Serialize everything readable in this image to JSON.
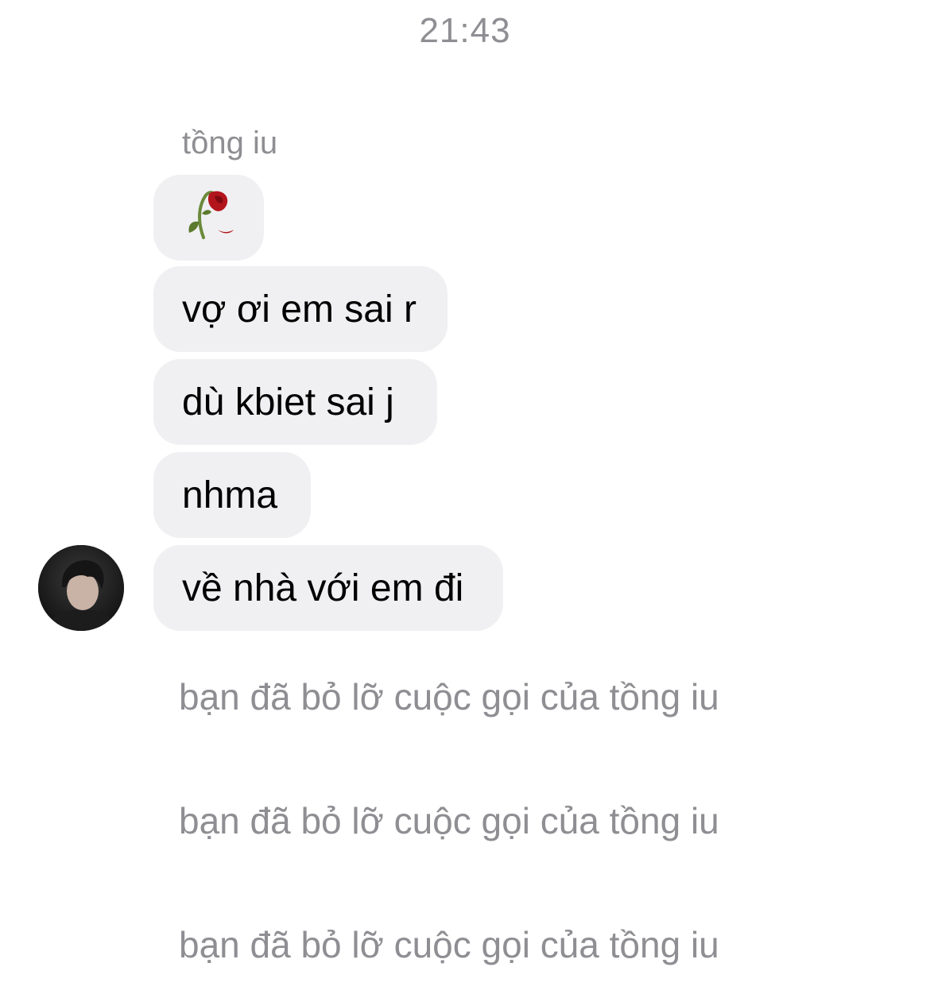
{
  "chat": {
    "timestamp": "21:43",
    "sender_name": "tồng iu",
    "messages": [
      {
        "type": "emoji",
        "icon": "wilted-rose-icon"
      },
      {
        "type": "text",
        "text": "vợ ơi em sai r"
      },
      {
        "type": "text",
        "text": "dù kbiet sai j"
      },
      {
        "type": "text",
        "text": "nhma"
      },
      {
        "type": "text",
        "text": "về nhà với em đi"
      }
    ],
    "call_notices": [
      "bạn đã bỏ lỡ cuộc gọi của tồng iu",
      "bạn đã bỏ lỡ cuộc gọi của tồng iu",
      "bạn đã bỏ lỡ cuộc gọi của tồng iu"
    ]
  },
  "colors": {
    "bubble": "#f0f0f2",
    "muted_text": "#8e8e93",
    "rose": "#b3151c",
    "stem": "#6b8a3a"
  }
}
